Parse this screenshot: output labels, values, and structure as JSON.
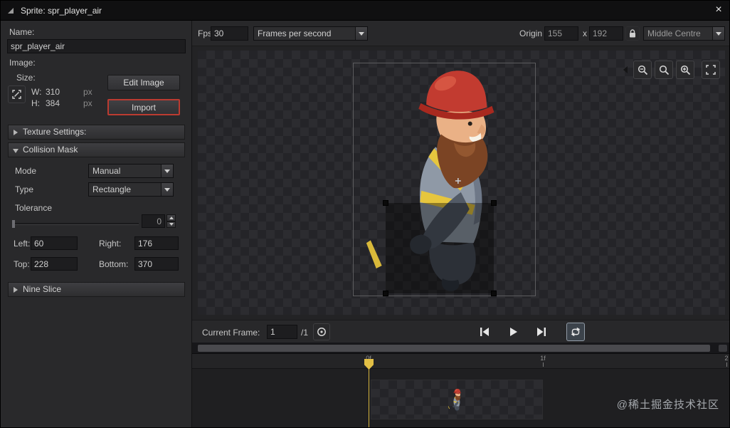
{
  "window": {
    "title": "Sprite: spr_player_air",
    "close_label": "×"
  },
  "left_panel": {
    "name_label": "Name:",
    "name_value": "spr_player_air",
    "image_label": "Image:",
    "size": {
      "label": "Size:",
      "w_label": "W:",
      "w_value": "310",
      "h_label": "H:",
      "h_value": "384",
      "unit": "px"
    },
    "edit_image_button": "Edit Image",
    "import_button": "Import",
    "texture_settings_header": "Texture Settings:",
    "collision_mask": {
      "header": "Collision Mask",
      "mode_label": "Mode",
      "mode_value": "Manual",
      "type_label": "Type",
      "type_value": "Rectangle",
      "tolerance_label": "Tolerance",
      "tolerance_value": "0",
      "left_label": "Left:",
      "left_value": "60",
      "right_label": "Right:",
      "right_value": "176",
      "top_label": "Top:",
      "top_value": "228",
      "bottom_label": "Bottom:",
      "bottom_value": "370"
    },
    "nine_slice_header": "Nine Slice"
  },
  "toolbar": {
    "fps_label": "Fps",
    "fps_value": "30",
    "fps_mode_value": "Frames per second",
    "origin_label": "Origin",
    "origin_x_value": "155",
    "origin_separator": "x",
    "origin_y_value": "192",
    "origin_mode_value": "Middle Centre"
  },
  "frame_bar": {
    "current_frame_label": "Current Frame:",
    "current_frame_value": "1",
    "total_frames": "/1"
  },
  "timeline": {
    "ticks": [
      {
        "label": "0f"
      },
      {
        "label": "1f"
      },
      {
        "label": "2"
      }
    ]
  },
  "watermark": "@稀土掘金技术社区",
  "colors": {
    "import_highlight": "#bb3b31",
    "playhead": "#e2bf45",
    "loop_active_border": "#919ba6"
  }
}
